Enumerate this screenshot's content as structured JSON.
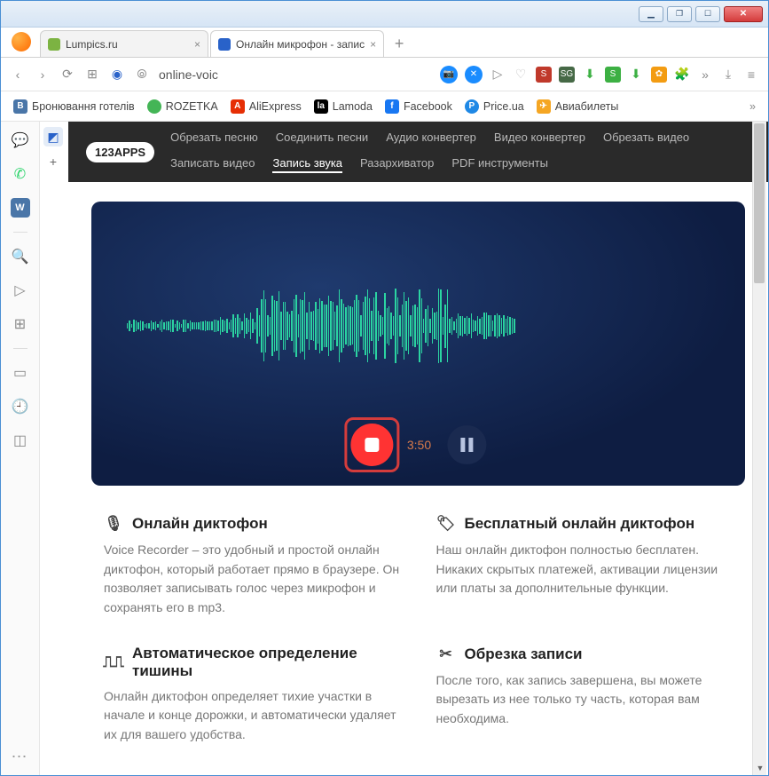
{
  "tabs": [
    {
      "title": "Lumpics.ru",
      "active": false
    },
    {
      "title": "Онлайн микрофон - запис",
      "active": true
    }
  ],
  "url": "online-voic",
  "bookmarks": {
    "b1": "Бронювання готелів",
    "b2": "ROZETKA",
    "b3": "AliExpress",
    "b4": "Lamoda",
    "b5": "Facebook",
    "b6": "Price.ua",
    "b7": "Авиабилеты"
  },
  "apps": {
    "logo": "123APPS",
    "nav": {
      "n1": "Обрезать песню",
      "n2": "Соединить песни",
      "n3": "Аудио конвертер",
      "n4": "Видео конвертер",
      "n5": "Обрезать видео",
      "n6": "Записать видео",
      "n7": "Запись звука",
      "n8": "Разархиватор",
      "n9": "PDF инструменты"
    }
  },
  "recorder": {
    "time": "3:50"
  },
  "features": {
    "f1": {
      "title": "Онлайн диктофон",
      "text": "Voice Recorder – это удобный и простой онлайн диктофон, который работает прямо в браузере. Он позволяет записывать голос через микрофон и сохранять его в mp3."
    },
    "f2": {
      "title": "Бесплатный онлайн диктофон",
      "text": "Наш онлайн диктофон полностью бесплатен. Никаких скрытых платежей, активации лицензии или платы за дополнительные функции."
    },
    "f3": {
      "title": "Автоматическое определение тишины",
      "text": "Онлайн диктофон определяет тихие участки в начале и конце дорожки, и автоматически удаляет их для вашего удобства."
    },
    "f4": {
      "title": "Обрезка записи",
      "text": "После того, как запись завершена, вы можете вырезать из нее только ту часть, которая вам необходима."
    }
  }
}
